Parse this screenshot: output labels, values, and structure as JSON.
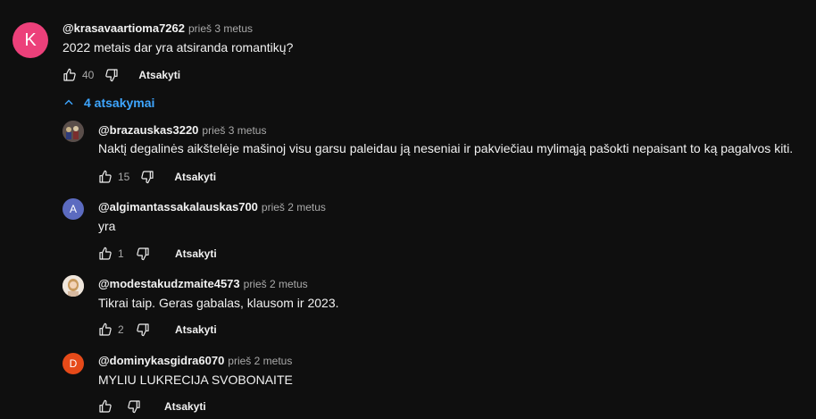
{
  "main_comment": {
    "avatar_letter": "K",
    "avatar_color": "#ec407a",
    "author": "@krasavaartioma7262",
    "time": "prieš 3 metus",
    "text": "2022 metais dar yra atsiranda romantikų?",
    "likes": "40",
    "reply_label": "Atsakyti"
  },
  "replies_toggle": {
    "label": "4 atsakymai"
  },
  "replies": [
    {
      "avatar_letter": "",
      "avatar_color": "#4a4a4a",
      "author": "@brazauskas3220",
      "time": "prieš 3 metus",
      "text": "Naktį degalinės aikštelėje mašinoj visu garsu paleidau ją neseniai ir pakviečiau mylimąją pašokti nepaisant to ką pagalvos kiti.",
      "likes": "15",
      "reply_label": "Atsakyti"
    },
    {
      "avatar_letter": "A",
      "avatar_color": "#5c6bc0",
      "author": "@algimantassakalauskas700",
      "time": "prieš 2 metus",
      "text": "yra",
      "likes": "1",
      "reply_label": "Atsakyti"
    },
    {
      "avatar_letter": "",
      "avatar_color": "#e8d9c8",
      "author": "@modestakudzmaite4573",
      "time": "prieš 2 metus",
      "text": "Tikrai taip. Geras gabalas, klausom ir 2023.",
      "likes": "2",
      "reply_label": "Atsakyti"
    },
    {
      "avatar_letter": "D",
      "avatar_color": "#e64a19",
      "author": "@dominykasgidra6070",
      "time": "prieš 2 metus",
      "text": "MYLIU LUKRECIJA SVOBONAITE",
      "likes": "",
      "reply_label": "Atsakyti"
    }
  ],
  "icons": {
    "like": "thumbs-up-icon",
    "dislike": "thumbs-down-icon",
    "toggle": "chevron-up-icon"
  }
}
